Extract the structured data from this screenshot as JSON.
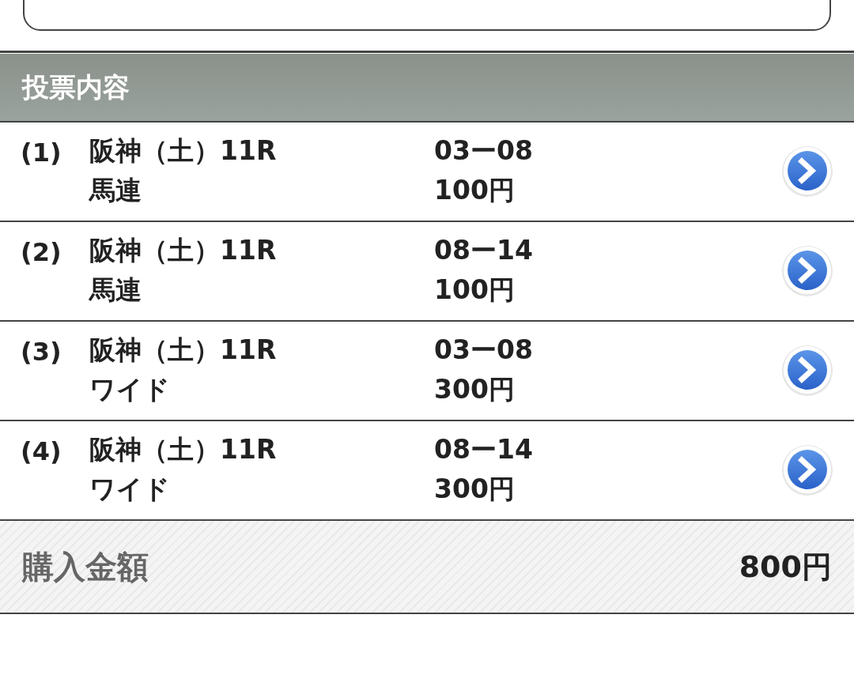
{
  "section": {
    "title": "投票内容"
  },
  "bets": [
    {
      "number": "(1)",
      "race": "阪神（土）11R",
      "type": "馬連",
      "combination": "03ー08",
      "amount": "100円"
    },
    {
      "number": "(2)",
      "race": "阪神（土）11R",
      "type": "馬連",
      "combination": "08ー14",
      "amount": "100円"
    },
    {
      "number": "(3)",
      "race": "阪神（土）11R",
      "type": "ワイド",
      "combination": "03ー08",
      "amount": "300円"
    },
    {
      "number": "(4)",
      "race": "阪神（土）11R",
      "type": "ワイド",
      "combination": "08ー14",
      "amount": "300円"
    }
  ],
  "total": {
    "label": "購入金額",
    "value": "800円"
  }
}
